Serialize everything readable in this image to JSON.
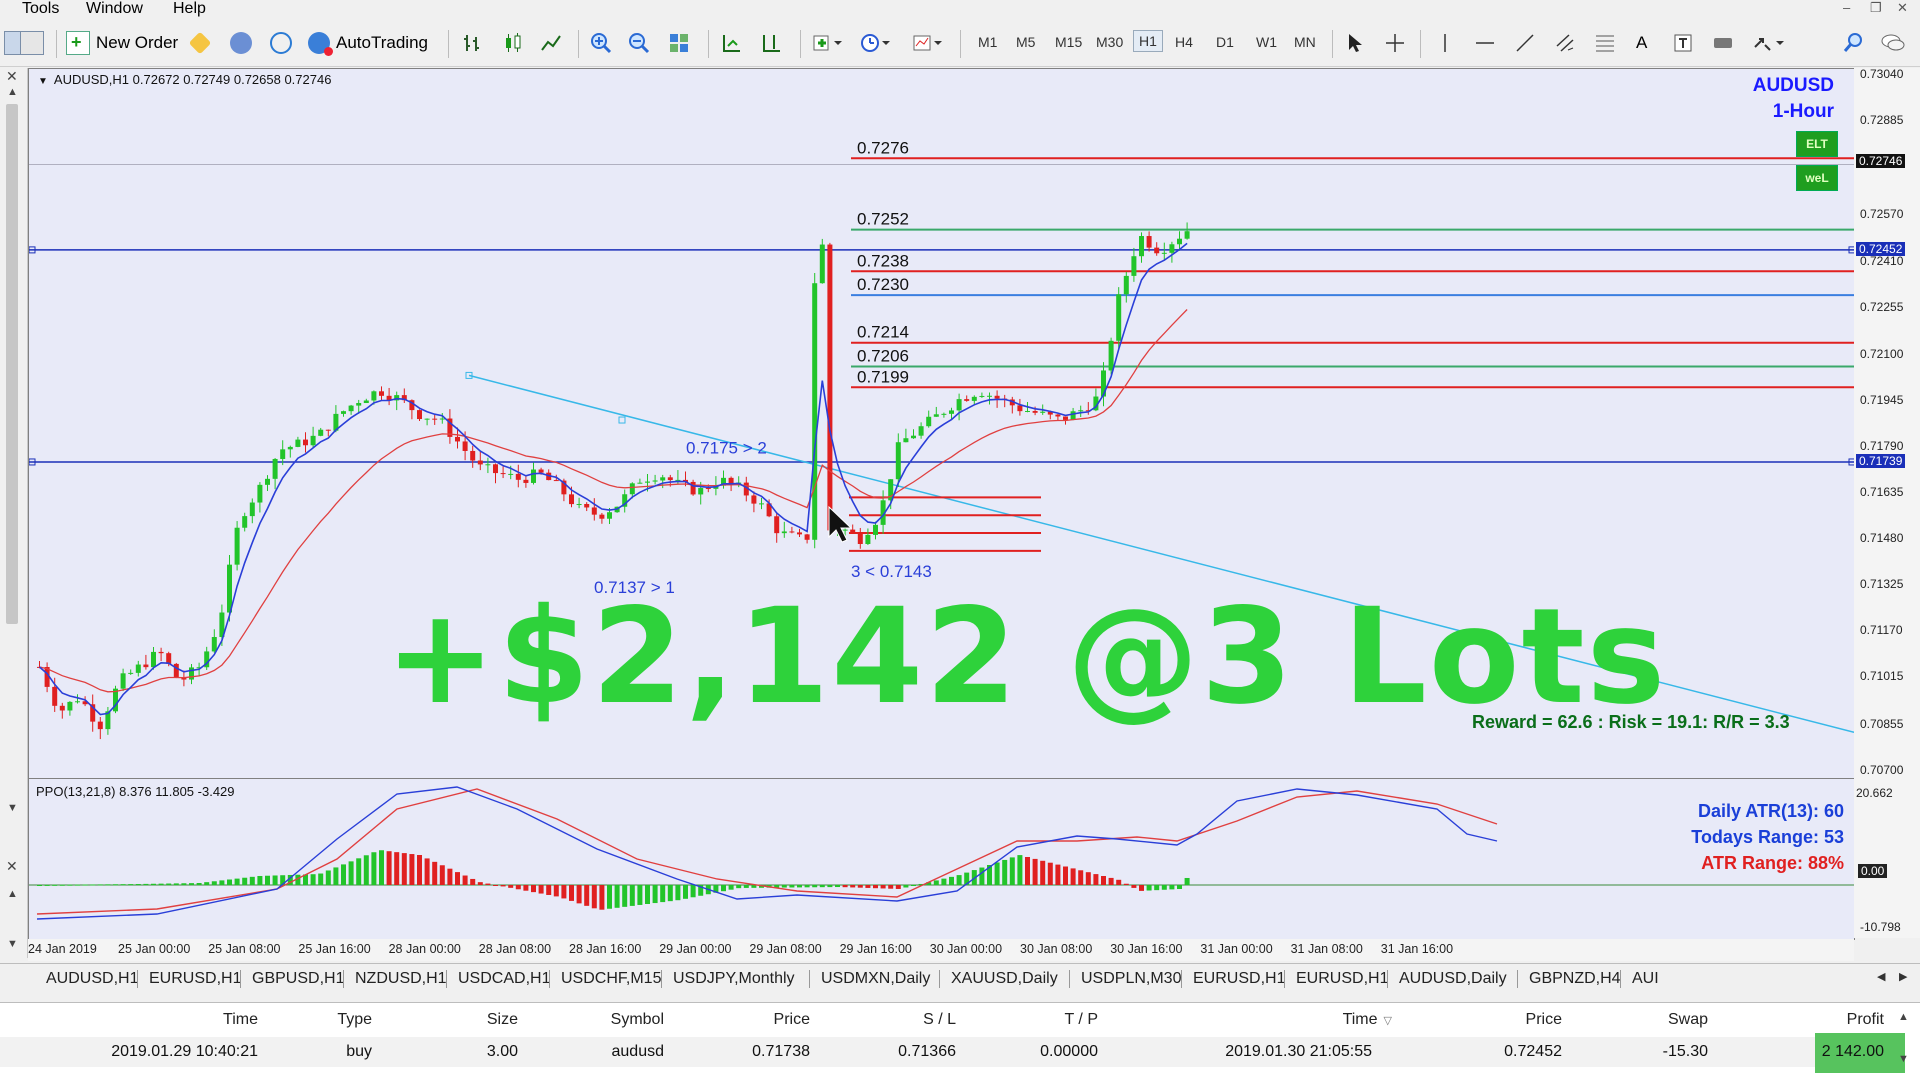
{
  "menu": {
    "items": [
      "Tools",
      "Window",
      "Help"
    ]
  },
  "toolbar": {
    "new_order": "New Order",
    "auto_trading": "AutoTrading",
    "timeframes": [
      "M1",
      "M5",
      "M15",
      "M30",
      "H1",
      "H4",
      "D1",
      "W1",
      "MN"
    ],
    "active_timeframe": "H1",
    "text_tool": "A"
  },
  "chart": {
    "header": "AUDUSD,H1  0.72672 0.72749 0.72658 0.72746",
    "symbol_label": "AUDUSD",
    "period_label": "1-Hour",
    "badges": [
      "ELT",
      "weL"
    ],
    "levels": [
      {
        "label": "0.7276",
        "price": 0.7276,
        "color": "#e02020"
      },
      {
        "label": "0.7252",
        "price": 0.7252,
        "color": "#3aa86a"
      },
      {
        "label": "0.7238",
        "price": 0.7238,
        "color": "#e02020"
      },
      {
        "label": "0.7230",
        "price": 0.723,
        "color": "#3a7ee0"
      },
      {
        "label": "0.7214",
        "price": 0.7214,
        "color": "#e02020"
      },
      {
        "label": "0.7206",
        "price": 0.7206,
        "color": "#3aa86a"
      },
      {
        "label": "0.7199",
        "price": 0.7199,
        "color": "#e02020"
      }
    ],
    "annotations": [
      "0.7175 > 2",
      "0.7137 > 1",
      "3 < 0.7143"
    ],
    "overlay_text": "+$2,142 @3 Lots",
    "rr_text": "Reward = 62.6 : Risk = 19.1: R/R = 3.3",
    "price_ticks": [
      "0.73040",
      "0.72885",
      "0.72746",
      "0.72570",
      "0.72452",
      "0.72410",
      "0.72255",
      "0.72100",
      "0.71945",
      "0.71790",
      "0.71739",
      "0.71635",
      "0.71480",
      "0.71325",
      "0.71170",
      "0.71015",
      "0.70855",
      "0.70700"
    ],
    "current_price": "0.72746",
    "hline_upper": "0.72452",
    "hline_lower": "0.71739",
    "time_ticks": [
      "24 Jan 2019",
      "25 Jan 00:00",
      "25 Jan 08:00",
      "25 Jan 16:00",
      "28 Jan 00:00",
      "28 Jan 08:00",
      "28 Jan 16:00",
      "29 Jan 00:00",
      "29 Jan 08:00",
      "29 Jan 16:00",
      "30 Jan 00:00",
      "30 Jan 08:00",
      "30 Jan 16:00",
      "31 Jan 00:00",
      "31 Jan 08:00",
      "31 Jan 16:00"
    ]
  },
  "ppo": {
    "label": "PPO(13,21,8) 8.376 11.805 -3.429",
    "top": "20.662",
    "zero": "0.00",
    "bottom": "-10.798",
    "daily_atr": "Daily ATR(13): 60",
    "todays_range": "Todays Range: 53",
    "atr_range": "ATR Range: 88%"
  },
  "tabs": [
    "AUDUSD,H1",
    "EURUSD,H1",
    "GBPUSD,H1",
    "NZDUSD,H1",
    "USDCAD,H1",
    "USDCHF,M15",
    "USDJPY,Monthly",
    "USDMXN,Daily",
    "XAUUSD,Daily",
    "USDPLN,M30",
    "EURUSD,H1",
    "EURUSD,H1",
    "AUDUSD,Daily",
    "GBPNZD,H4",
    "AUI"
  ],
  "trade": {
    "headers": [
      "Time",
      "Type",
      "Size",
      "Symbol",
      "Price",
      "S / L",
      "T / P",
      "Time",
      "Price",
      "Swap",
      "Profit"
    ],
    "row": [
      "2019.01.29 10:40:21",
      "buy",
      "3.00",
      "audusd",
      "0.71738",
      "0.71366",
      "0.00000",
      "2019.01.30 21:05:55",
      "0.72452",
      "-15.30",
      "2 142.00"
    ]
  },
  "colors": {
    "bull": "#22c42a",
    "bear": "#e02020",
    "ema_fast": "#2a3fd8",
    "ema_slow": "#e04040",
    "trend": "#37b8e8",
    "chart_bg": "#e8eaf8",
    "overlay": "#2ed23b"
  }
}
